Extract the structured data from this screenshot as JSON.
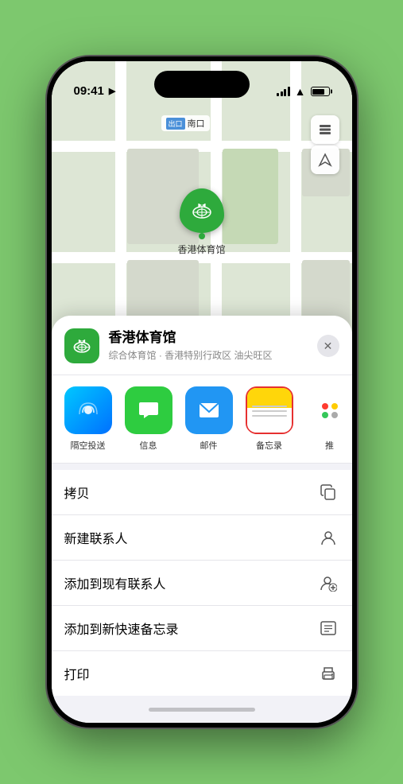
{
  "status_bar": {
    "time": "09:41",
    "location_icon": "▶"
  },
  "map": {
    "label_tag": "出口",
    "label_text": "南口",
    "marker_label": "香港体育馆"
  },
  "place_header": {
    "name": "香港体育馆",
    "subtitle": "综合体育馆 · 香港特别行政区 油尖旺区",
    "close_label": "✕"
  },
  "share_items": [
    {
      "id": "airdrop",
      "label": "隔空投送"
    },
    {
      "id": "messages",
      "label": "信息"
    },
    {
      "id": "mail",
      "label": "邮件"
    },
    {
      "id": "notes",
      "label": "备忘录"
    },
    {
      "id": "more",
      "label": "推"
    }
  ],
  "actions": [
    {
      "label": "拷贝",
      "icon": "copy"
    },
    {
      "label": "新建联系人",
      "icon": "person"
    },
    {
      "label": "添加到现有联系人",
      "icon": "person-add"
    },
    {
      "label": "添加到新快速备忘录",
      "icon": "memo"
    },
    {
      "label": "打印",
      "icon": "print"
    }
  ]
}
